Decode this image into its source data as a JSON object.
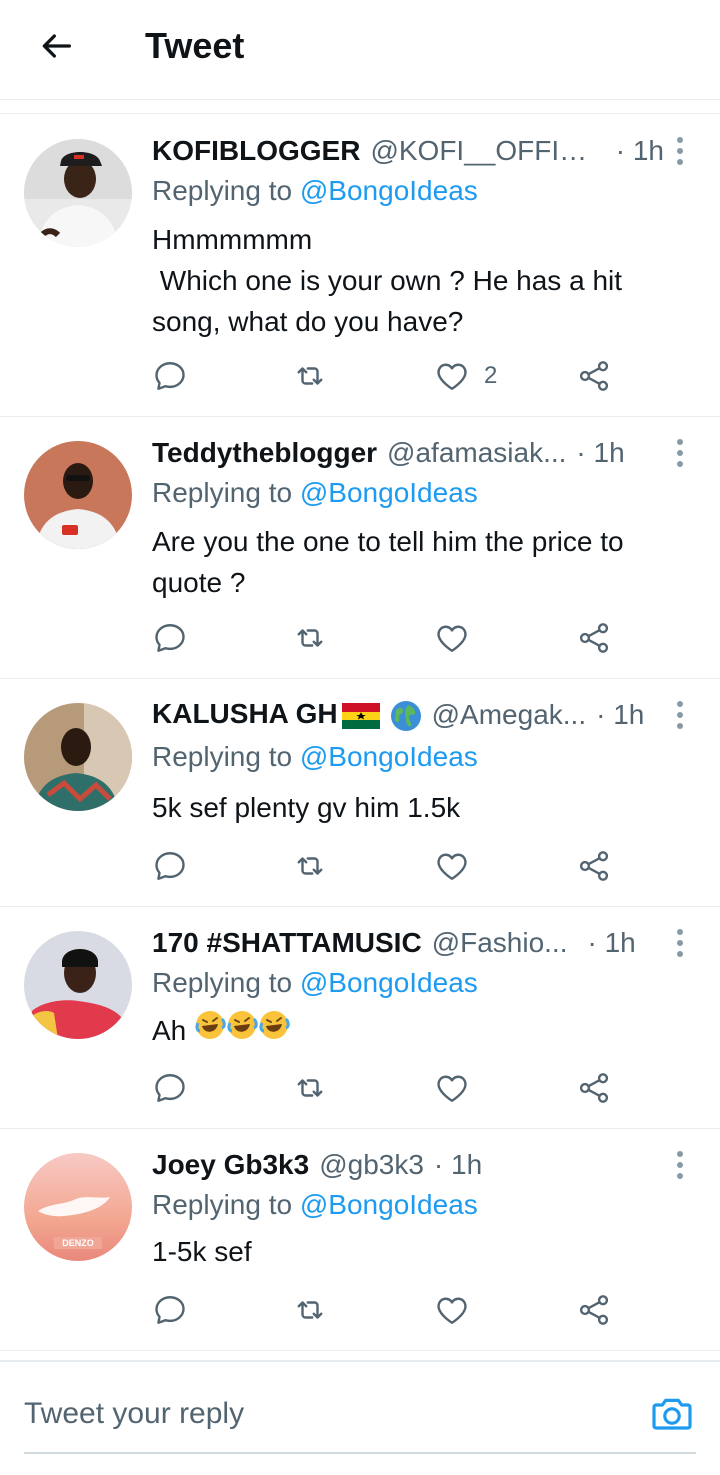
{
  "header": {
    "title": "Tweet"
  },
  "tweets": [
    {
      "name": "KOFIBLOGGER",
      "handle": "@KOFI__OFFICI...",
      "time": "· 1h",
      "replying_prefix": "Replying to ",
      "replying_to": "@BongoIdeas",
      "text": "Hmmmmmm\n Which one is your own ? He has a hit song, what do you have?",
      "likes": "2"
    },
    {
      "name": "Teddytheblogger",
      "handle": "@afamasiak...",
      "time": "· 1h",
      "replying_prefix": "Replying to ",
      "replying_to": "@BongoIdeas",
      "text": "Are you the one to tell him the price to quote ?",
      "likes": ""
    },
    {
      "name": "KALUSHA GH",
      "handle": "@Amegak...",
      "time": "· 1h",
      "replying_prefix": "Replying to ",
      "replying_to": "@BongoIdeas",
      "text": "5k sef plenty gv him 1.5k",
      "likes": ""
    },
    {
      "name": "170 #SHATTAMUSIC",
      "handle": "@Fashio...",
      "time": "· 1h",
      "replying_prefix": "Replying to ",
      "replying_to": "@BongoIdeas",
      "text": "Ah ",
      "likes": ""
    },
    {
      "name": "Joey Gb3k3",
      "handle": "@gb3k3",
      "time": "· 1h",
      "replying_prefix": "Replying to ",
      "replying_to": "@BongoIdeas",
      "text": "1-5k sef",
      "likes": ""
    }
  ],
  "avatar_5_text": "DENZO",
  "reply": {
    "placeholder": "Tweet your reply"
  },
  "colors": {
    "accent": "#1d9bf0",
    "text": "#0f1419",
    "secondary": "#536471",
    "border": "#e6ecf0"
  }
}
